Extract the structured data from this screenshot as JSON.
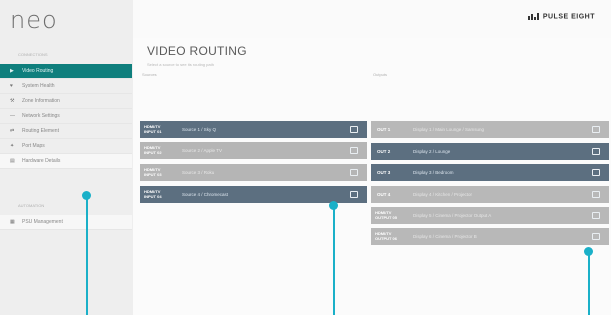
{
  "logo": "neo",
  "brand": "PULSE EIGHT",
  "sidebar": {
    "section1": "Connections",
    "items": [
      {
        "label": "Video Routing",
        "icon": "play-icon",
        "active": true
      },
      {
        "label": "System Health",
        "icon": "heart-icon"
      },
      {
        "label": "Zone Information",
        "icon": "wrench-icon"
      },
      {
        "label": "Network Settings",
        "icon": "network-icon"
      },
      {
        "label": "Routing Element",
        "icon": "route-icon"
      },
      {
        "label": "Port Maps",
        "icon": "map-icon"
      },
      {
        "label": "Hardware Details",
        "icon": "chip-icon"
      }
    ],
    "section2": "Automation",
    "items2": [
      {
        "label": "PSU Management",
        "icon": "grid-icon"
      }
    ]
  },
  "main": {
    "title": "VIDEO ROUTING",
    "subtitle": "Select a source to see its routing path",
    "sources_label": "Sources",
    "destinations_label": "Outputs",
    "sources": [
      {
        "tag1": "HDMI/TV",
        "tag2": "INPUT 01",
        "label": "Source 1 / Sky Q",
        "selected": true
      },
      {
        "tag1": "HDMI/TV",
        "tag2": "INPUT 02",
        "label": "Source 2 / Apple TV",
        "selected": false
      },
      {
        "tag1": "HDMI/TV",
        "tag2": "INPUT 03",
        "label": "Source 3 / Roku",
        "selected": false
      },
      {
        "tag1": "HDMI/TV",
        "tag2": "INPUT 04",
        "label": "Source 4 / Chromecast",
        "selected": true
      }
    ],
    "destinations": [
      {
        "tag": "OUT 1",
        "label": "Display 1 / Main Lounge / Samsung",
        "active": false
      },
      {
        "tag": "OUT 2",
        "label": "Display 2 / Lounge",
        "active": true
      },
      {
        "tag": "OUT 3",
        "label": "Display 3 / Bedroom",
        "active": true
      },
      {
        "tag": "OUT 4",
        "label": "Display 4 / Kitchen / Projector",
        "active": false
      },
      {
        "tag1": "HDMI/TV",
        "tag2": "OUTPUT 05",
        "label": "Display 5 / Cinema / Projector Output A",
        "active": false
      },
      {
        "tag1": "HDMI/TV",
        "tag2": "OUTPUT 06",
        "label": "Display 6 / Cinema / Projector B",
        "active": false
      }
    ]
  }
}
